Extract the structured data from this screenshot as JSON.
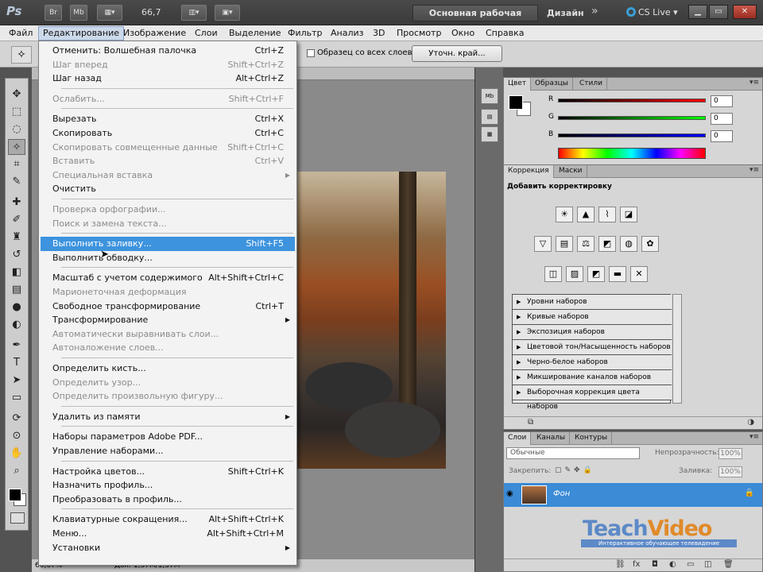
{
  "appbar": {
    "logo": "Ps",
    "br": "Br",
    "mb": "Mb",
    "zoom": "66,7",
    "workspace": "Основная рабочая среда",
    "workspace2": "Дизайн",
    "more": "»",
    "cslive": "CS Live"
  },
  "menubar": [
    "Файл",
    "Редактирование",
    "Изображение",
    "Слои",
    "Выделение",
    "Фильтр",
    "Анализ",
    "3D",
    "Просмотр",
    "Окно",
    "Справка"
  ],
  "options": {
    "sample_all_layers": "Образец со всех слоев",
    "refine_edge": "Уточн. край..."
  },
  "edit_menu": [
    {
      "label": "Отменить: Волшебная палочка",
      "shortcut": "Ctrl+Z",
      "disabled": false
    },
    {
      "label": "Шаг вперед",
      "shortcut": "Shift+Ctrl+Z",
      "disabled": true
    },
    {
      "label": "Шаг назад",
      "shortcut": "Alt+Ctrl+Z",
      "disabled": false
    },
    {
      "sep": true
    },
    {
      "label": "Ослабить...",
      "shortcut": "Shift+Ctrl+F",
      "disabled": true
    },
    {
      "sep": true
    },
    {
      "label": "Вырезать",
      "shortcut": "Ctrl+X",
      "disabled": false
    },
    {
      "label": "Скопировать",
      "shortcut": "Ctrl+C",
      "disabled": false
    },
    {
      "label": "Скопировать совмещенные данные",
      "shortcut": "Shift+Ctrl+C",
      "disabled": true
    },
    {
      "label": "Вставить",
      "shortcut": "Ctrl+V",
      "disabled": true
    },
    {
      "label": "Специальная вставка",
      "shortcut": "",
      "disabled": true,
      "submenu": true
    },
    {
      "label": "Очистить",
      "shortcut": "",
      "disabled": false
    },
    {
      "sep": true
    },
    {
      "label": "Проверка орфографии...",
      "shortcut": "",
      "disabled": true
    },
    {
      "label": "Поиск и замена текста...",
      "shortcut": "",
      "disabled": true
    },
    {
      "sep": true
    },
    {
      "label": "Выполнить заливку...",
      "shortcut": "Shift+F5",
      "disabled": false,
      "highlighted": true
    },
    {
      "label": "Выполнить обводку...",
      "shortcut": "",
      "disabled": false
    },
    {
      "sep": true
    },
    {
      "label": "Масштаб с учетом содержимого",
      "shortcut": "Alt+Shift+Ctrl+C",
      "disabled": false
    },
    {
      "label": "Марионеточная деформация",
      "shortcut": "",
      "disabled": true
    },
    {
      "label": "Свободное трансформирование",
      "shortcut": "Ctrl+T",
      "disabled": false
    },
    {
      "label": "Трансформирование",
      "shortcut": "",
      "disabled": false,
      "submenu": true
    },
    {
      "label": "Автоматически выравнивать слои...",
      "shortcut": "",
      "disabled": true
    },
    {
      "label": "Автоналожение слоев...",
      "shortcut": "",
      "disabled": true
    },
    {
      "sep": true
    },
    {
      "label": "Определить кисть...",
      "shortcut": "",
      "disabled": false
    },
    {
      "label": "Определить узор...",
      "shortcut": "",
      "disabled": true
    },
    {
      "label": "Определить произвольную фигуру...",
      "shortcut": "",
      "disabled": true
    },
    {
      "sep": true
    },
    {
      "label": "Удалить из памяти",
      "shortcut": "",
      "disabled": false,
      "submenu": true
    },
    {
      "sep": true
    },
    {
      "label": "Наборы параметров Adobe PDF...",
      "shortcut": "",
      "disabled": false
    },
    {
      "label": "Управление наборами...",
      "shortcut": "",
      "disabled": false
    },
    {
      "sep": true
    },
    {
      "label": "Настройка цветов...",
      "shortcut": "Shift+Ctrl+K",
      "disabled": false
    },
    {
      "label": "Назначить профиль...",
      "shortcut": "",
      "disabled": false
    },
    {
      "label": "Преобразовать в профиль...",
      "shortcut": "",
      "disabled": false
    },
    {
      "sep": true
    },
    {
      "label": "Клавиатурные сокращения...",
      "shortcut": "Alt+Shift+Ctrl+K",
      "disabled": false
    },
    {
      "label": "Меню...",
      "shortcut": "Alt+Shift+Ctrl+M",
      "disabled": false
    },
    {
      "label": "Установки",
      "shortcut": "",
      "disabled": false,
      "submenu": true
    }
  ],
  "color_panel": {
    "tabs": [
      "Цвет",
      "Образцы",
      "Стили"
    ],
    "r_label": "R",
    "g_label": "G",
    "b_label": "B",
    "r": "0",
    "g": "0",
    "b": "0"
  },
  "adjust_panel": {
    "tabs": [
      "Коррекция",
      "Маски"
    ],
    "title": "Добавить корректировку",
    "presets": [
      "Уровни наборов",
      "Кривые наборов",
      "Экспозиция наборов",
      "Цветовой тон/Насыщенность наборов",
      "Черно-белое наборов",
      "Микширование каналов наборов",
      "Выборочная коррекция цвета наборов"
    ]
  },
  "layers_panel": {
    "tabs": [
      "Слои",
      "Каналы",
      "Контуры"
    ],
    "blend": "Обычные",
    "opacity_label": "Непрозрачность:",
    "opacity": "100%",
    "lock_label": "Закрепить:",
    "fill_label": "Заливка:",
    "fill": "100%",
    "layer_name": "Фон"
  },
  "status": {
    "zoom": "66,67%",
    "doc": "Док: 1,37M/1,37M"
  },
  "watermark": {
    "teach": "Teach",
    "video": "Video",
    "sub": "Интерактивное обучающее телевидение"
  },
  "colors": {
    "highlight": "#3d93de",
    "layer_selected": "#3b8bd6"
  }
}
